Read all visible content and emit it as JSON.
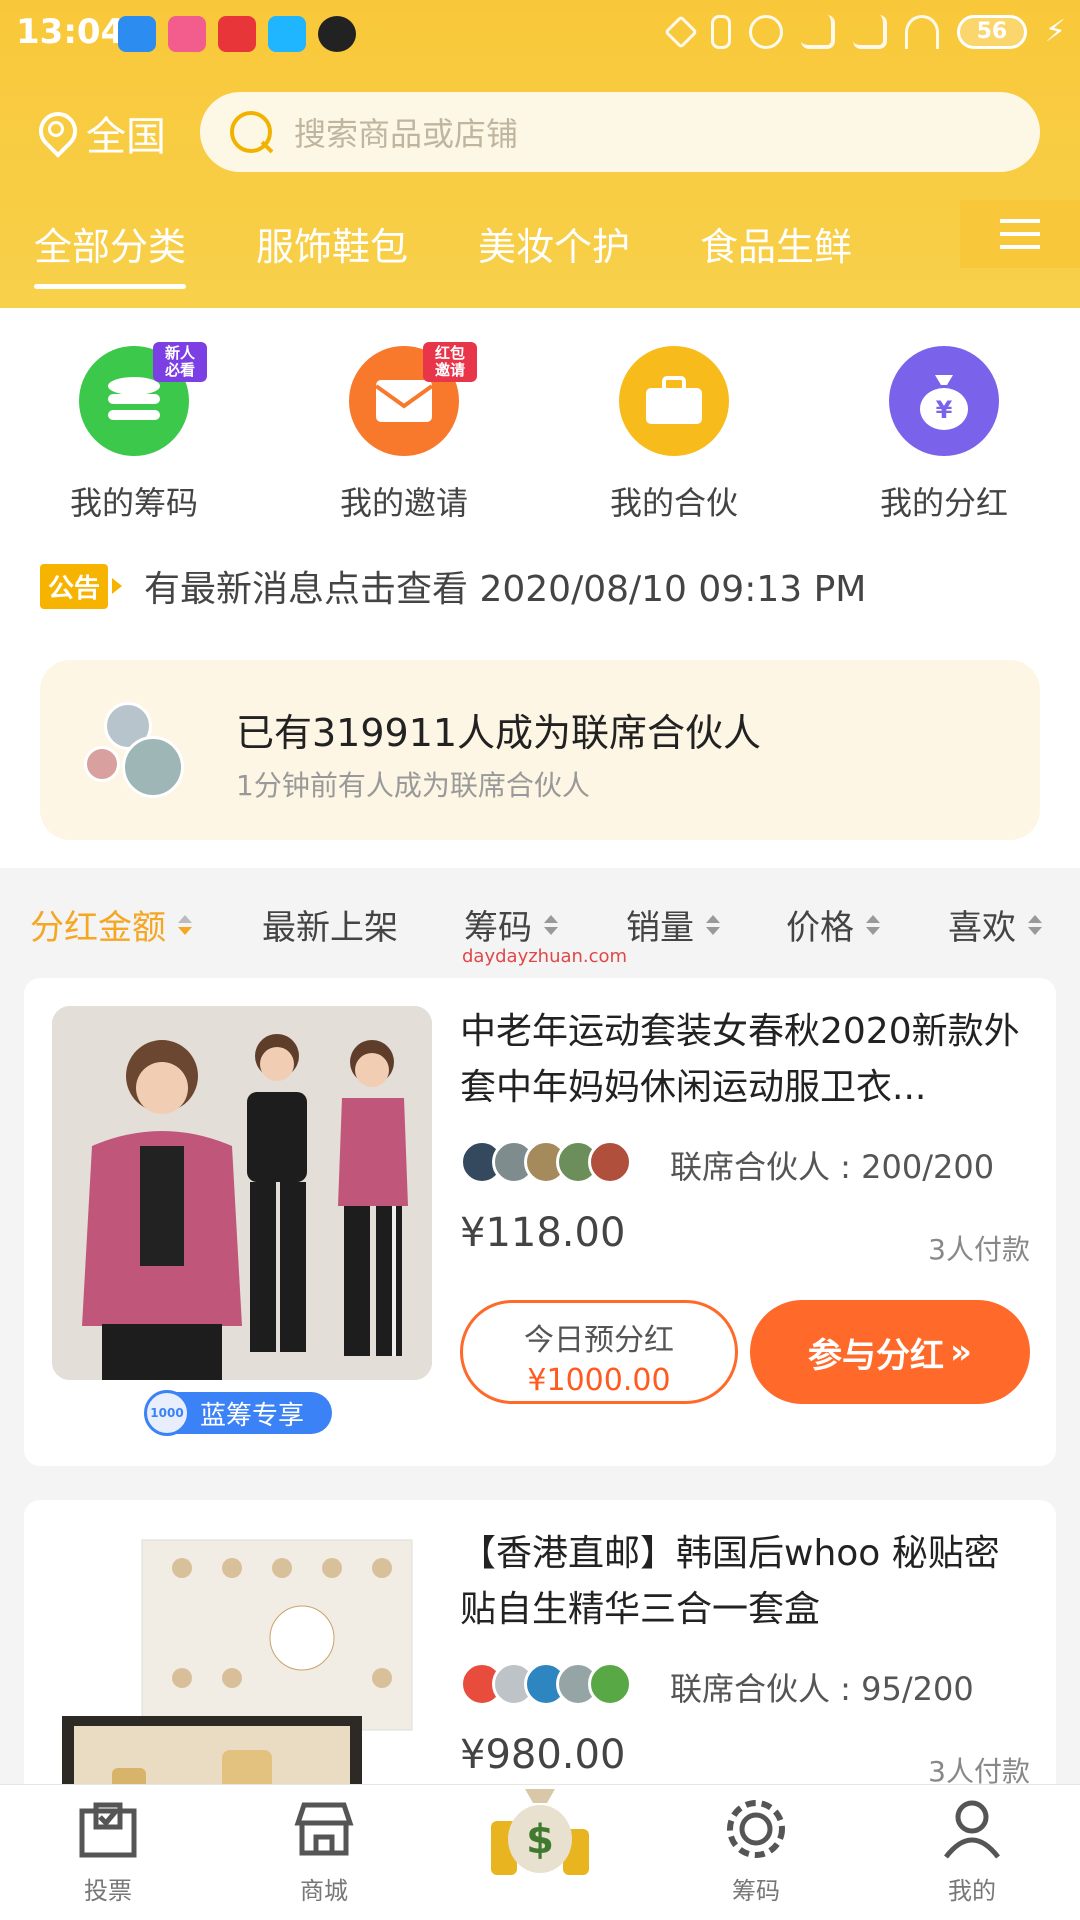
{
  "status_bar": {
    "time": "13:04",
    "battery": "56"
  },
  "header": {
    "location": "全国",
    "search_placeholder": "搜索商品或店铺",
    "tabs": [
      "全部分类",
      "服饰鞋包",
      "美妆个护",
      "食品生鲜"
    ]
  },
  "quick_links": [
    {
      "label": "我的筹码",
      "badge": "新人必看",
      "color": "#3cc84a",
      "icon": "coins-icon"
    },
    {
      "label": "我的邀请",
      "badge": "红包邀请",
      "color": "#f8792b",
      "icon": "envelope-icon"
    },
    {
      "label": "我的合伙",
      "badge": "",
      "color": "#f8bb1c",
      "icon": "briefcase-icon"
    },
    {
      "label": "我的分红",
      "badge": "",
      "color": "#7a62ea",
      "icon": "money-bag-icon"
    }
  ],
  "notice": {
    "tag": "公告",
    "text": "有最新消息点击查看 2020/08/10 09:13 PM"
  },
  "partner_banner": {
    "title": "已有319911人成为联席合伙人",
    "subtitle": "1分钟前有人成为联席合伙人"
  },
  "sort_options": [
    "分红金额",
    "最新上架",
    "筹码",
    "销量",
    "价格",
    "喜欢"
  ],
  "watermark": "daydayzhuan.com",
  "products": [
    {
      "title": "中老年运动套装女春秋2020新款外套中年妈妈休闲运动服卫衣...",
      "partners": "联席合伙人 : 200/200",
      "price": "¥118.00",
      "paid": "3人付款",
      "today_label": "今日预分红",
      "today_value": "¥1000.00",
      "join_label": "参与分红",
      "chip": "蓝筹专享",
      "chip_coin": "1000"
    },
    {
      "title": "【香港直邮】韩国后whoo 秘贴密贴自生精华三合一套盒",
      "partners": "联席合伙人 : 95/200",
      "price": "¥980.00",
      "paid": "3人付款"
    }
  ],
  "bottom_nav": [
    {
      "label": "投票",
      "icon": "vote-box-icon"
    },
    {
      "label": "商城",
      "icon": "store-icon"
    },
    {
      "label": "",
      "icon": "money-bag-gold-icon"
    },
    {
      "label": "筹码",
      "icon": "chip-icon"
    },
    {
      "label": "我的",
      "icon": "person-icon"
    }
  ]
}
